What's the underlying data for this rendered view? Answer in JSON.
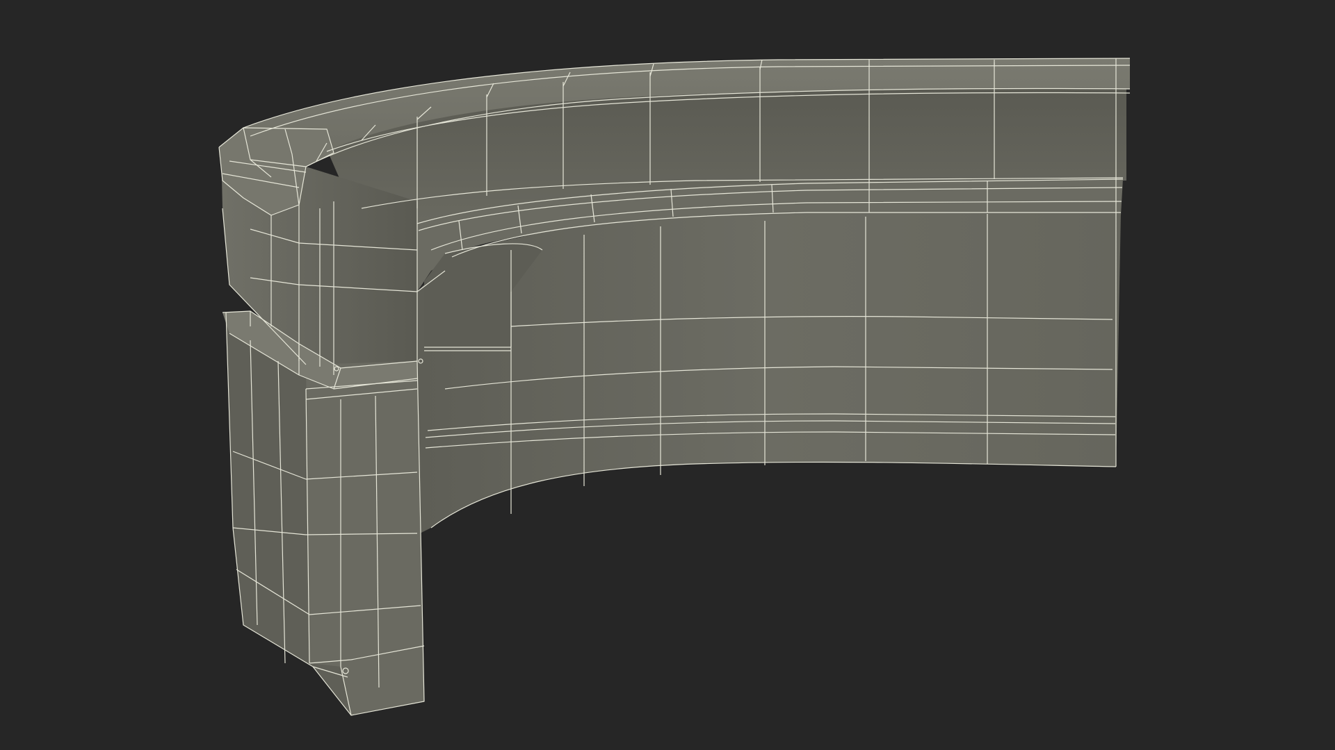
{
  "scene": {
    "background_color": "#262626",
    "object_name": "curved-reception-desk",
    "render_mode": "wireframe-on-shaded",
    "colors": {
      "face_light": "#6e6e64",
      "face_mid": "#66665d",
      "face_dark": "#55554d",
      "face_shadow": "#4a4a44",
      "wire": "#e8e8dc"
    }
  }
}
